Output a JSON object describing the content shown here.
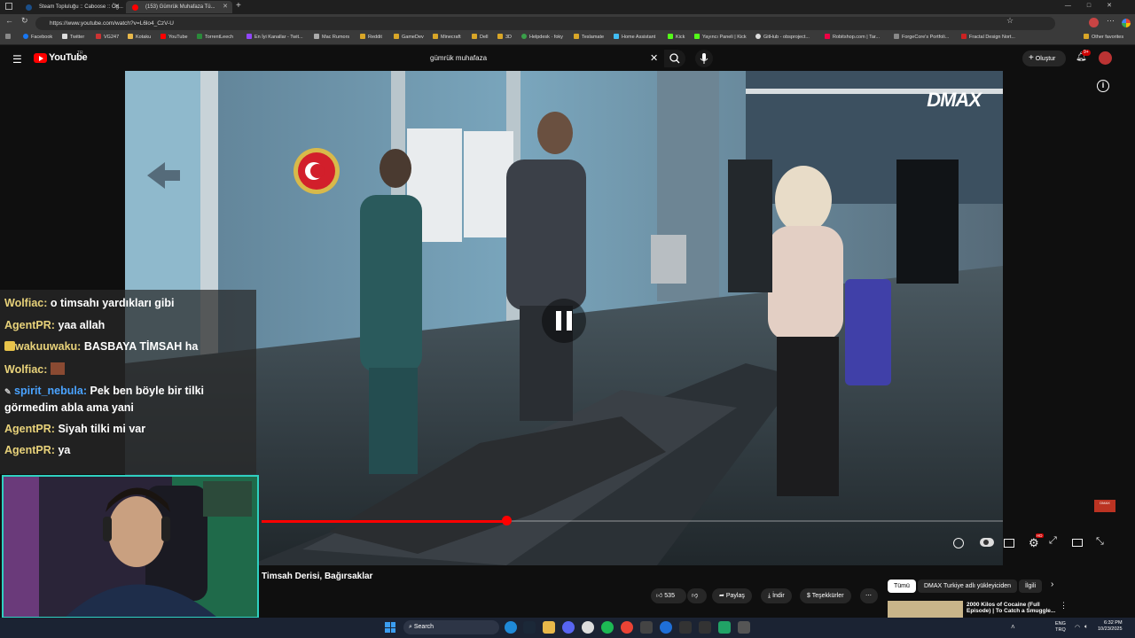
{
  "browser": {
    "tabs": [
      {
        "title": "Steam Topluluğu :: Caboose :: Ög..."
      },
      {
        "title": "(153) Gümrük Muhafaza Tü..."
      }
    ],
    "url": "https://www.youtube.com/watch?v=L6lo4_CzV-U",
    "bookmarks": [
      "Facebook",
      "Twitter",
      "VG247",
      "Kotaku",
      "YouTube",
      "TorrentLeech",
      "En İyi Kanallar - Twit...",
      "Mac Rumors",
      "Reddit",
      "GameDev",
      "Minecraft",
      "Dell",
      "3D",
      "Helpdesk · foky",
      "Teslamate",
      "Home Assistant",
      "Kick",
      "Yayıncı Paneli | Kick",
      "GitHub - obsproject...",
      "Robitshop.com | Tar...",
      "ForgeCore's Portfoli...",
      "Fractal Design Nort..."
    ],
    "other_bookmarks": "Other favorites"
  },
  "youtube": {
    "logo": "YouTube",
    "logo_country": "TR",
    "search_query": "gümrük muhafaza",
    "create_label": "Oluştur",
    "notification_count": "9+"
  },
  "video": {
    "watermark": "DMAX",
    "progress": 0.33,
    "title": "Timsah Derisi, Bağırsaklar"
  },
  "chat": [
    {
      "user": "Wolfiac:",
      "text": "o timsahı yardıkları gibi",
      "color": "gold"
    },
    {
      "user": "AgentPR:",
      "text": "yaa allah",
      "color": "gold"
    },
    {
      "user": "wakuuwaku:",
      "text": "BASBAYA TİMSAH ha",
      "color": "gold"
    },
    {
      "user": "Wolfiac:",
      "text": "",
      "color": "gold"
    },
    {
      "user": "spirit_nebula:",
      "text": "Pek ben böyle bir tilki",
      "text2": "görmedim abla ama yani",
      "color": "blue"
    },
    {
      "user": "AgentPR:",
      "text": "Siyah tilki mi var",
      "color": "gold"
    },
    {
      "user": "AgentPR:",
      "text": "ya",
      "color": "gold"
    }
  ],
  "actions": {
    "like_count": "535",
    "share": "Paylaş",
    "download": "İndir",
    "thanks": "Teşekkürler"
  },
  "chips": [
    "Tümü",
    "DMAX Turkiye adlı yükleyiciden",
    "İlgili"
  ],
  "recommendation": {
    "title": "2000 Kilos of Cocaine (Full",
    "title2": "Episode) | To Catch a Smuggle..."
  },
  "taskbar": {
    "search": "Search",
    "lang1": "ENG",
    "lang2": "TRQ",
    "time": "6:32 PM",
    "date": "10/23/2025"
  }
}
